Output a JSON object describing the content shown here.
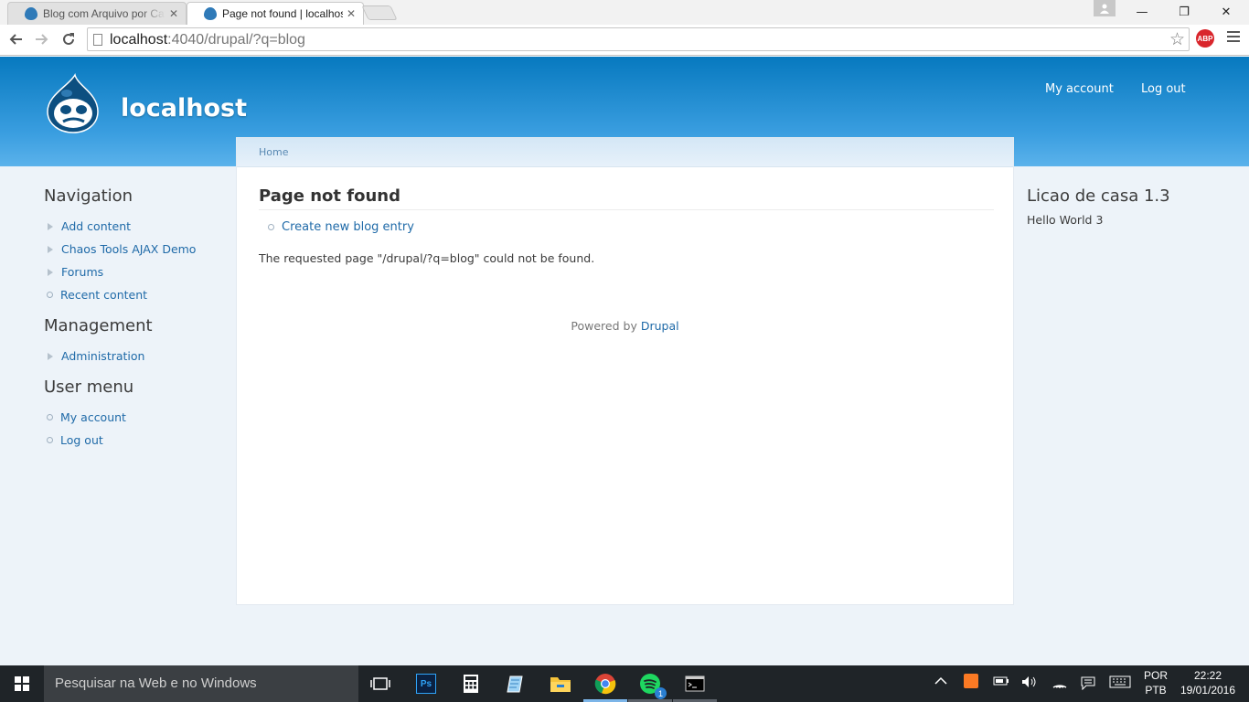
{
  "browser": {
    "tabs": [
      {
        "title": "Blog com Arquivo por Cat",
        "active": false
      },
      {
        "title": "Page not found | localhost",
        "active": true
      }
    ],
    "url_host": "localhost",
    "url_rest": ":4040/drupal/?q=blog",
    "abp_label": "ABP",
    "icons": {
      "back": "back-arrow-icon",
      "forward": "forward-arrow-icon",
      "reload": "reload-icon",
      "star": "bookmark-star-icon",
      "menu": "chrome-menu-icon"
    }
  },
  "site": {
    "name": "localhost",
    "secondary_menu": [
      {
        "label": "My account"
      },
      {
        "label": "Log out"
      }
    ],
    "brand_color": "#0779bf"
  },
  "breadcrumb": {
    "home": "Home"
  },
  "main": {
    "title": "Page not found",
    "action_link": "Create new blog entry",
    "message": "The requested page \"/drupal/?q=blog\" could not be found.",
    "footer_prefix": "Powered by ",
    "footer_link": "Drupal"
  },
  "sidebar_first": {
    "navigation": {
      "title": "Navigation",
      "items": [
        {
          "label": "Add content",
          "marker": "triangle"
        },
        {
          "label": "Chaos Tools AJAX Demo",
          "marker": "triangle"
        },
        {
          "label": "Forums",
          "marker": "triangle"
        },
        {
          "label": "Recent content",
          "marker": "circle"
        }
      ]
    },
    "management": {
      "title": "Management",
      "items": [
        {
          "label": "Administration",
          "marker": "triangle"
        }
      ]
    },
    "user_menu": {
      "title": "User menu",
      "items": [
        {
          "label": "My account",
          "marker": "circle"
        },
        {
          "label": "Log out",
          "marker": "circle"
        }
      ]
    }
  },
  "sidebar_second": {
    "title": "Licao de casa 1.3",
    "body": "Hello World 3"
  },
  "taskbar": {
    "search_placeholder": "Pesquisar na Web e no Windows",
    "language_top": "POR",
    "language_bottom": "PTB",
    "time": "22:22",
    "date": "19/01/2016",
    "spotify_badge": "1",
    "pinned_icons": [
      "task-view-icon",
      "photoshop-icon",
      "calculator-icon",
      "notepad-icon",
      "file-explorer-icon",
      "chrome-icon",
      "spotify-icon",
      "cmd-icon"
    ]
  }
}
